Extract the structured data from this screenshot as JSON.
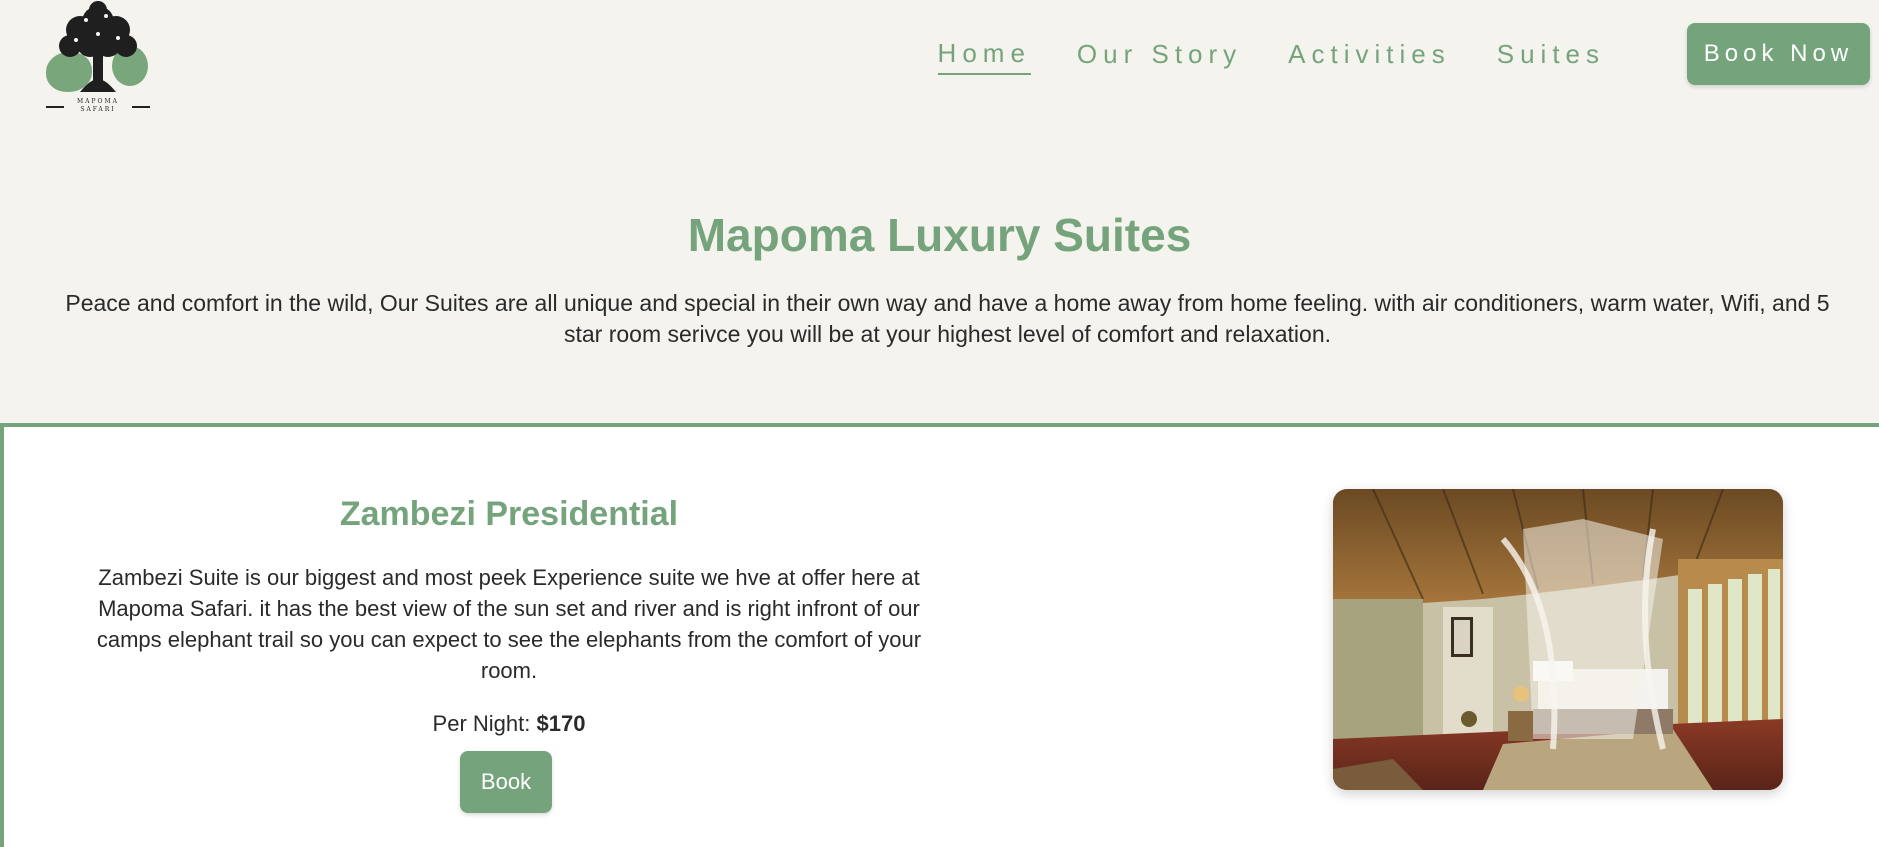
{
  "brand": {
    "logo_text_line1": "MAPOMA",
    "logo_text_line2": "SAFARI",
    "accent_color": "#75a47c"
  },
  "nav": {
    "items": [
      {
        "label": "Home",
        "active": true
      },
      {
        "label": "Our Story",
        "active": false
      },
      {
        "label": "Activities",
        "active": false
      },
      {
        "label": "Suites",
        "active": false
      }
    ],
    "cta_label": "Book Now"
  },
  "hero": {
    "title": "Mapoma Luxury Suites",
    "description": "Peace and comfort in the wild, Our Suites are all unique and special in their own way and have a home away from home feeling. with air conditioners, warm water, Wifi, and 5 star room serivce you will be at your highest level of comfort and relaxation."
  },
  "suite": {
    "title": "Zambezi Presidential",
    "description": "Zambezi Suite is our biggest and most peek Experience suite we hve at offer here at Mapoma Safari. it has the best view of the sun set and river and is right infront of our camps elephant trail so you can expect to see the elephants from the comfort of your room.",
    "price_label": "Per Night:",
    "price_value": "$170",
    "book_label": "Book"
  }
}
